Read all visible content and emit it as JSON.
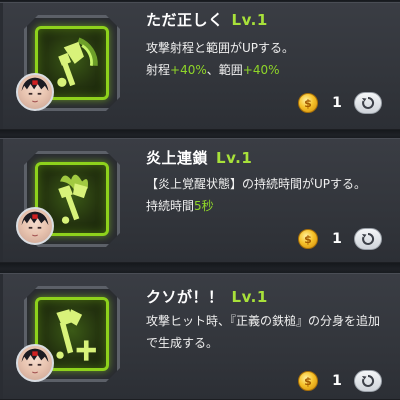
{
  "skills": [
    {
      "title": "ただ正しく",
      "level": "Lv.1",
      "desc_line1": "攻撃射程と範囲がUPする。",
      "desc_line2_a": "射程",
      "desc_line2_b": "+40%",
      "desc_line2_c": "、範囲",
      "desc_line2_d": "+40%",
      "cost": "1",
      "icon": "axe-range-icon"
    },
    {
      "title": "炎上連鎖",
      "level": "Lv.1",
      "desc_line1": "【炎上覚醒状態】の持続時間がUPする。",
      "desc_line2_a": "持続時間",
      "desc_line2_b": "5秒",
      "cost": "1",
      "icon": "axe-flame-icon"
    },
    {
      "title": "クソが！！",
      "level": "Lv.1",
      "desc_line1": "攻撃ヒット時、『正義の鉄槌』の分身を追加",
      "desc_line2_a": "で生成する。",
      "cost": "1",
      "icon": "axe-plus-icon"
    }
  ],
  "colors": {
    "accent_green": "#8fd629",
    "level_green": "#a8e13a",
    "card_bg": "#35383e",
    "coin_gold": "#f6c22a"
  }
}
